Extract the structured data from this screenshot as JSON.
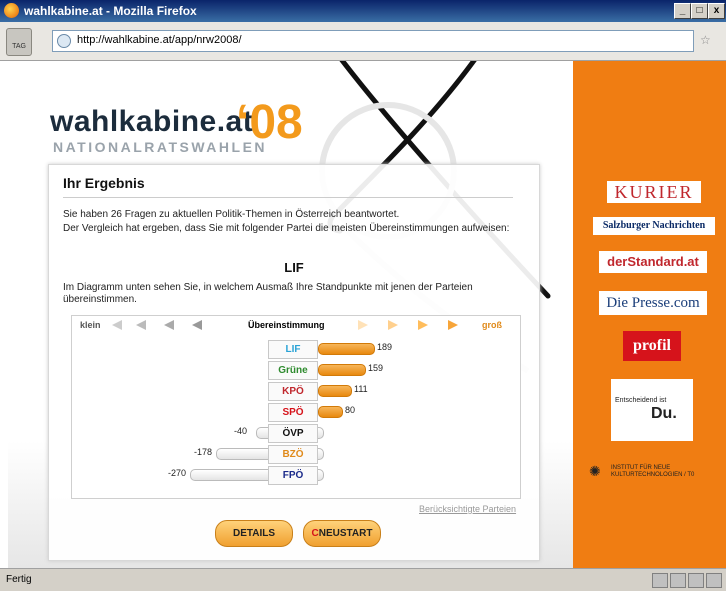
{
  "window": {
    "title": "wahlkabine.at - Mozilla Firefox",
    "buttons": [
      "_",
      "□",
      "x"
    ]
  },
  "browser": {
    "url": "http://wahlkabine.at/app/nrw2008/",
    "tag_label": "TAG",
    "status": "Fertig"
  },
  "logo": {
    "main": "wahlkabine.at",
    "year": "‘08",
    "sub": "NATIONALRATSWAHLEN"
  },
  "result": {
    "heading": "Ihr Ergebnis",
    "line1": "Sie haben 26 Fragen zu aktuellen Politik-Themen in Österreich beantwortet.",
    "line2": "Der Vergleich hat ergeben, dass Sie mit folgender Partei die meisten Übereinstimmungen aufweisen:",
    "party": "LIF",
    "line3": "Im Diagramm unten sehen Sie, in welchem Ausmaß Ihre Standpunkte mit jenen der Parteien übereinstimmen."
  },
  "chart_header": {
    "left": "klein",
    "middle": "Übereinstimmung",
    "right": "groß"
  },
  "chart_data": {
    "type": "bar",
    "categories": [
      "LIF",
      "Grüne",
      "KPÖ",
      "SPÖ",
      "ÖVP",
      "BZÖ",
      "FPÖ"
    ],
    "values": [
      189,
      159,
      111,
      80,
      -40,
      -178,
      -270
    ],
    "label_colors": [
      "#29a3d6",
      "#2e8b2e",
      "#c0272d",
      "#d6131b",
      "#111111",
      "#e08a1a",
      "#1a2a8a"
    ]
  },
  "footer_link": "Berücksichtigte Parteien",
  "buttons": {
    "details": "DETAILS",
    "restart": "NEUSTART"
  },
  "sponsors": {
    "kurier": "KURIER",
    "sn": "Salzburger Nachrichten",
    "standard": "derStandard.at",
    "presse": "Die Presse.com",
    "profil": "profil",
    "ent1": "Entscheidend ist",
    "ent2": "Du.",
    "ikt": "INSTITUT FÜR NEUE KULTURTECHNOLOGIEN / T0"
  }
}
